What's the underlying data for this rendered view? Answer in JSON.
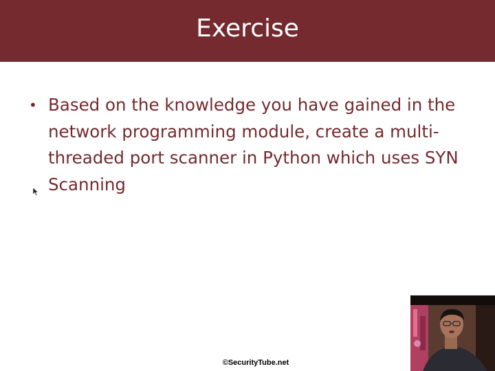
{
  "slide": {
    "title": "Exercise",
    "bullets": [
      "Based on the knowledge you have gained in the network programming module, create a multi-threaded port scanner in Python which uses SYN Scanning"
    ],
    "footer": "©SecurityTube.net"
  },
  "colors": {
    "title_bar": "#742a2e",
    "title_text": "#ffffff",
    "body_text": "#742a2e",
    "background": "#ffffff"
  },
  "overlays": {
    "cursor_icon": "mouse-pointer-icon",
    "webcam": "presenter-webcam-feed"
  }
}
